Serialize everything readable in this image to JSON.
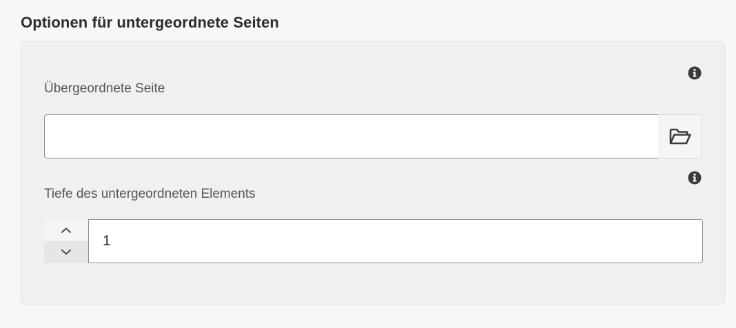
{
  "section": {
    "title": "Optionen für untergeordnete Seiten"
  },
  "parent_page": {
    "label": "Übergeordnete Seite",
    "value": "",
    "placeholder": "",
    "info_icon": "info-icon",
    "browse_icon": "folder-open-icon"
  },
  "child_depth": {
    "label": "Tiefe des untergeordneten Elements",
    "value": "1",
    "info_icon": "info-icon",
    "increment_icon": "chevron-up-icon",
    "decrement_icon": "chevron-down-icon"
  },
  "colors": {
    "background": "#f7f7f7",
    "panel": "#f0f0f0",
    "input_border": "#8e8e8e",
    "text": "#2c2c2c",
    "label": "#555555"
  }
}
